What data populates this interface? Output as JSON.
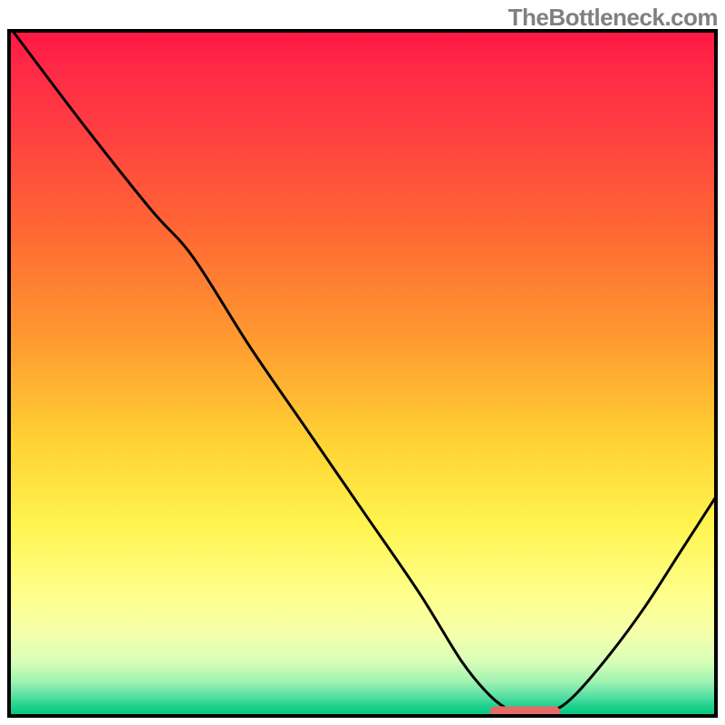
{
  "watermark": "TheBottleneck.com",
  "chart_data": {
    "type": "line",
    "title": "",
    "xlabel": "",
    "ylabel": "",
    "xlim": [
      0,
      100
    ],
    "ylim": [
      0,
      100
    ],
    "gradient_stops": [
      {
        "offset": 0.0,
        "color": "#ff1744"
      },
      {
        "offset": 0.06,
        "color": "#ff2a46"
      },
      {
        "offset": 0.15,
        "color": "#ff4040"
      },
      {
        "offset": 0.3,
        "color": "#ff6a33"
      },
      {
        "offset": 0.45,
        "color": "#ff9a30"
      },
      {
        "offset": 0.6,
        "color": "#ffd233"
      },
      {
        "offset": 0.72,
        "color": "#fff44f"
      },
      {
        "offset": 0.82,
        "color": "#ffff8a"
      },
      {
        "offset": 0.88,
        "color": "#f5ffaa"
      },
      {
        "offset": 0.92,
        "color": "#d8ffb8"
      },
      {
        "offset": 0.95,
        "color": "#a0f2b2"
      },
      {
        "offset": 0.97,
        "color": "#5ce0a5"
      },
      {
        "offset": 0.985,
        "color": "#22d28f"
      },
      {
        "offset": 1.0,
        "color": "#00c37a"
      }
    ],
    "curve_points": [
      {
        "x": 0.5,
        "y": 100
      },
      {
        "x": 10,
        "y": 87
      },
      {
        "x": 20,
        "y": 74
      },
      {
        "x": 26,
        "y": 67
      },
      {
        "x": 34,
        "y": 54
      },
      {
        "x": 42,
        "y": 42
      },
      {
        "x": 50,
        "y": 30
      },
      {
        "x": 58,
        "y": 18
      },
      {
        "x": 64,
        "y": 8
      },
      {
        "x": 68,
        "y": 3
      },
      {
        "x": 71,
        "y": 0.8
      },
      {
        "x": 74,
        "y": 0.5
      },
      {
        "x": 77,
        "y": 0.8
      },
      {
        "x": 80,
        "y": 3
      },
      {
        "x": 85,
        "y": 9
      },
      {
        "x": 90,
        "y": 16
      },
      {
        "x": 95,
        "y": 24
      },
      {
        "x": 100,
        "y": 32
      }
    ],
    "marker": {
      "x_center": 73,
      "y": 0.5,
      "width": 10,
      "height": 1.8,
      "color": "#e46a6a"
    },
    "frame": {
      "stroke": "#000000",
      "stroke_width": 4
    },
    "curve_style": {
      "stroke": "#000000",
      "stroke_width": 3
    }
  }
}
